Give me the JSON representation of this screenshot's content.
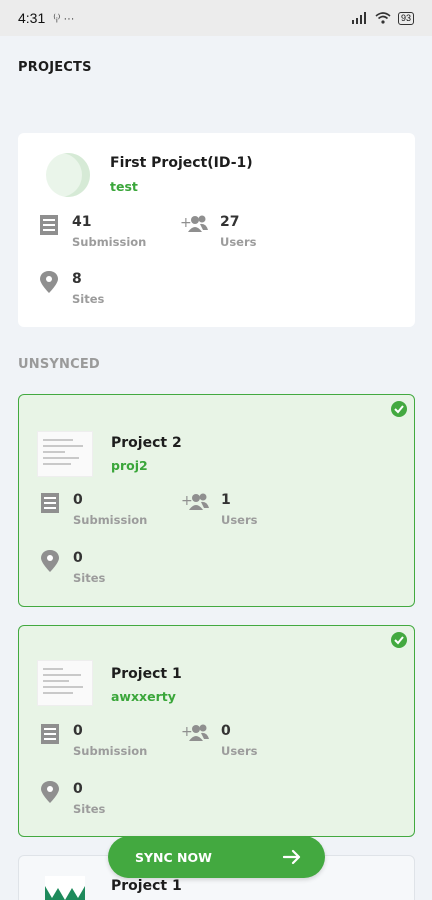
{
  "status_bar": {
    "time": "4:31",
    "left_extra": "⁽ᵢ⁾ ···",
    "battery": "93"
  },
  "sections": {
    "projects": "PROJECTS",
    "unsynced": "UNSYNCED"
  },
  "projects": [
    {
      "name": "First Project(ID-1)",
      "subtitle": "test",
      "submission_count": "41",
      "submission_label": "Submission",
      "users_count": "27",
      "users_label": "Users",
      "sites_count": "8",
      "sites_label": "Sites"
    }
  ],
  "unsynced": [
    {
      "name": "Project 2",
      "subtitle": "proj2",
      "submission_count": "0",
      "submission_label": "Submission",
      "users_count": "1",
      "users_label": "Users",
      "sites_count": "0",
      "sites_label": "Sites"
    },
    {
      "name": "Project 1",
      "subtitle": "awxxerty",
      "submission_count": "0",
      "submission_label": "Submission",
      "users_count": "0",
      "users_label": "Users",
      "sites_count": "0",
      "sites_label": "Sites"
    },
    {
      "name": "Project 1"
    }
  ],
  "sync_button": {
    "label": "SYNC NOW"
  },
  "colors": {
    "accent": "#43a940",
    "card_synced_bg": "#e8f4e6",
    "page_bg": "#f0f3f7"
  },
  "icons": [
    "form-icon",
    "add-users-icon",
    "location-pin-icon",
    "check-circle-icon",
    "arrow-right-icon"
  ]
}
